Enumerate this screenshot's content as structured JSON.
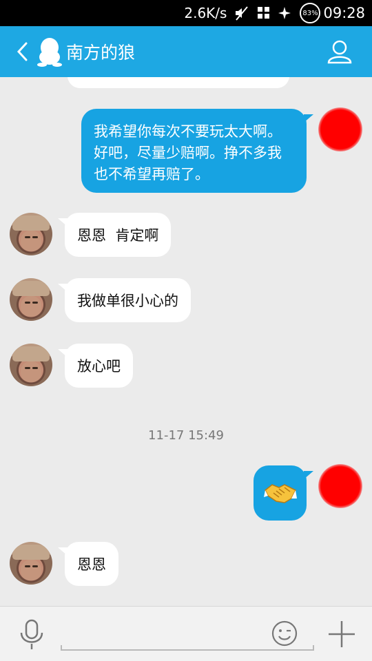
{
  "status_bar": {
    "net_speed": "2.6K/s",
    "battery": "83%",
    "time": "09:28",
    "icons": [
      "mute-icon",
      "grid-icon",
      "sparkle-icon",
      "battery-icon"
    ]
  },
  "header": {
    "title": "南方的狼",
    "accent_color": "#1ea8e3",
    "icons": [
      "back-icon",
      "qq-penguin-icon",
      "profile-icon"
    ]
  },
  "messages": [
    {
      "side": "out",
      "type": "text",
      "text": "我希望你每次不要玩太大啊。好吧，尽量少赔啊。挣不多我也不希望再赔了。"
    },
    {
      "side": "in",
      "type": "text",
      "text": "恩恩  肯定啊"
    },
    {
      "side": "in",
      "type": "text",
      "text": "我做单很小心的"
    },
    {
      "side": "in",
      "type": "text",
      "text": "放心吧"
    },
    {
      "side": "out",
      "type": "emoji",
      "emoji_icon": "handshake-icon"
    },
    {
      "side": "in",
      "type": "text",
      "text": "恩恩"
    }
  ],
  "timestamp": "11-17 15:49",
  "colors": {
    "out_bubble": "#17a3e2",
    "in_bubble": "#ffffff",
    "chat_background": "#ebebeb"
  },
  "input_bar": {
    "placeholder": "",
    "icons": [
      "microphone-icon",
      "smiley-icon",
      "plus-icon"
    ]
  }
}
